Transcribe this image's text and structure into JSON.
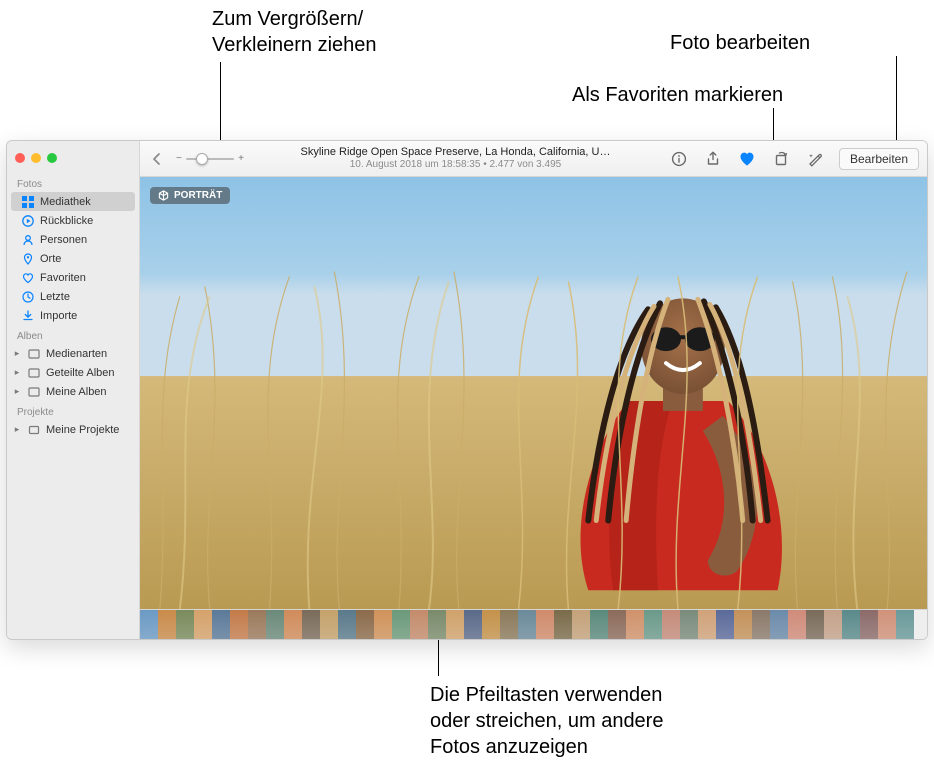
{
  "callouts": {
    "zoom": "Zum Vergrößern/\nVerkleinern ziehen",
    "favorite": "Als Favoriten markieren",
    "edit": "Foto bearbeiten",
    "filmstrip": "Die Pfeiltasten verwenden\noder streichen, um andere\nFotos anzuzeigen"
  },
  "toolbar": {
    "title": "Skyline Ridge Open Space Preserve, La Honda, California, U…",
    "subtitle": "10. August 2018 um 18:58:35   •   2.477 von 3.495",
    "edit_label": "Bearbeiten"
  },
  "badge": {
    "label": "PORTRÄT"
  },
  "sidebar": {
    "section_photos": "Fotos",
    "items_photos": [
      {
        "label": "Mediathek",
        "icon": "grid"
      },
      {
        "label": "Rückblicke",
        "icon": "play"
      },
      {
        "label": "Personen",
        "icon": "person"
      },
      {
        "label": "Orte",
        "icon": "pin"
      },
      {
        "label": "Favoriten",
        "icon": "heart"
      },
      {
        "label": "Letzte",
        "icon": "clock"
      },
      {
        "label": "Importe",
        "icon": "download"
      }
    ],
    "section_albums": "Alben",
    "items_albums": [
      {
        "label": "Medienarten"
      },
      {
        "label": "Geteilte Alben"
      },
      {
        "label": "Meine Alben"
      }
    ],
    "section_projects": "Projekte",
    "items_projects": [
      {
        "label": "Meine Projekte"
      }
    ]
  },
  "thumb_colors": [
    "#6b9ac4",
    "#c98b4a",
    "#7a8b5c",
    "#d5a26b",
    "#5b7a99",
    "#c47b4a",
    "#9b7a5b",
    "#6b8a7a",
    "#d08b5a",
    "#7a6b5a",
    "#c4a26b",
    "#5a7a8b",
    "#8b6b4a",
    "#d0925a",
    "#6b9a7a",
    "#c48b6b",
    "#7a8b6b",
    "#d0a26b",
    "#5b6a8a",
    "#c4924a",
    "#8b7a5b",
    "#6b8a9a",
    "#d08b6b",
    "#7a6b4a",
    "#c4a27a",
    "#5a8a7b",
    "#8b6b5a",
    "#d0926b",
    "#6b9a8a",
    "#c48b7a",
    "#7a8b7b",
    "#d0a27a",
    "#5b6a9a",
    "#c4925a",
    "#8b7a6b",
    "#6b8aaa",
    "#d08b7a",
    "#7a6b5a",
    "#c4a28a",
    "#5a8a8b",
    "#8b6b6a",
    "#d0927a",
    "#6b9a9a"
  ]
}
